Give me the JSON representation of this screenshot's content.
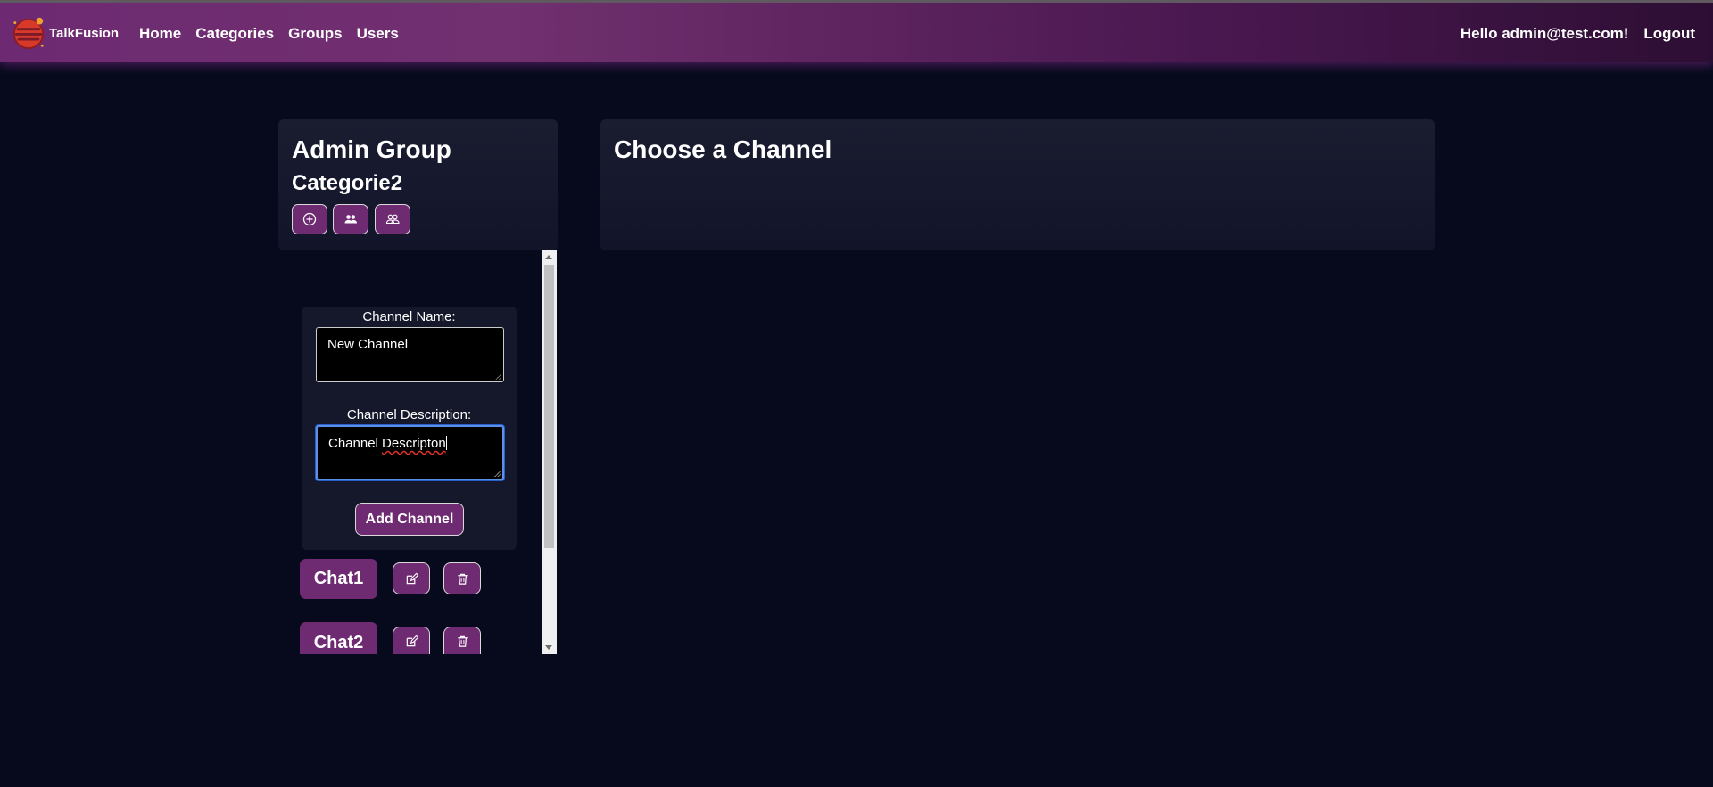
{
  "nav": {
    "brand": "TalkFusion",
    "links": [
      "Home",
      "Categories",
      "Groups",
      "Users"
    ],
    "greeting": "Hello admin@test.com!",
    "logout": "Logout"
  },
  "sidebar": {
    "group_name": "Admin Group",
    "category_name": "Categorie2",
    "actions": [
      "add-icon",
      "users-icon",
      "group-users-icon"
    ]
  },
  "form": {
    "name_label": "Channel Name:",
    "name_value": "New Channel",
    "desc_label": "Channel Description:",
    "desc_value_prefix": "Channel ",
    "desc_value_misspelled": "Descripton",
    "submit_label": "Add Channel"
  },
  "channels": [
    {
      "name": "Chat1"
    },
    {
      "name": "Chat2"
    }
  ],
  "main": {
    "title": "Choose a Channel"
  },
  "colors": {
    "background": "#070a1d",
    "accent": "#6f2b71",
    "nav_start": "#6d2a72",
    "nav_end": "#2d0e33"
  }
}
